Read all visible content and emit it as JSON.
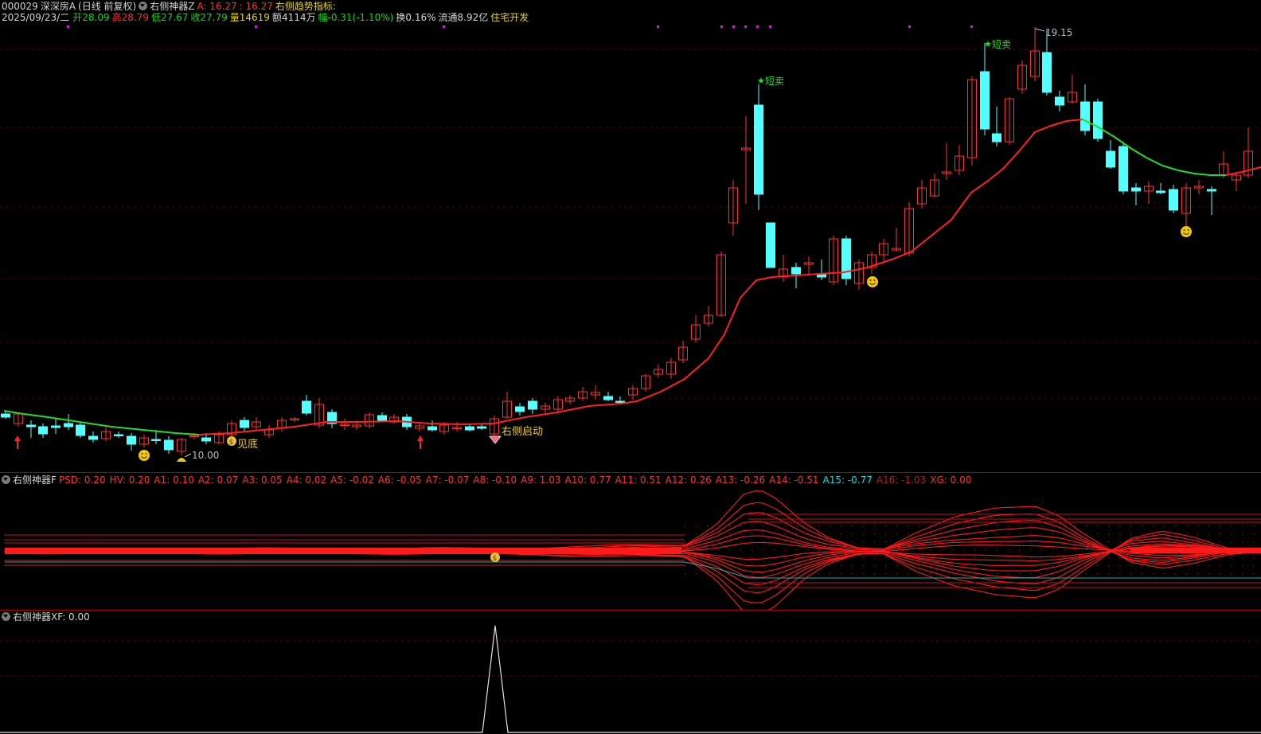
{
  "header": {
    "code": "000029",
    "name": "深深房A",
    "period": "(日线 前复权)",
    "indicator_name": "右侧神器Z",
    "a_label": "A: 16.27",
    "a_value2": ": 16.27",
    "trend_label": "右侧趋势指标:",
    "date": "2025/09/23/二",
    "open_label": "开",
    "open": "28.09",
    "high_label": "高",
    "high": "28.79",
    "low_label": "低",
    "low": "27.67",
    "close_label": "收",
    "close": "27.79",
    "vol_label": "量",
    "vol": "14619",
    "amt_label": "额",
    "amt": "4114万",
    "chg_label": "幅",
    "chg": "-0.31(-1.10%)",
    "turnover": "换0.16%",
    "float": "流通8.92亿",
    "sector": "住宅开发"
  },
  "main_chart": {
    "price_high_label": "19.15",
    "price_low_label": "10.00",
    "short_sell_label": "短卖",
    "bottom_label": "见底",
    "right_start_label": "右侧启动",
    "colors": {
      "up": "#ff3030",
      "down": "#54ffff",
      "ma_up": "#ff2020",
      "ma_down": "#22dd22",
      "bg": "#000000"
    }
  },
  "panel_f": {
    "title": "右侧神器F",
    "values": [
      {
        "k": "PSD: 0.20",
        "cls": "r"
      },
      {
        "k": "HV: 0.20",
        "cls": "r"
      },
      {
        "k": "A1: 0.10",
        "cls": "r"
      },
      {
        "k": "A2: 0.07",
        "cls": "r"
      },
      {
        "k": "A3: 0.05",
        "cls": "r"
      },
      {
        "k": "A4: 0.02",
        "cls": "r"
      },
      {
        "k": "A5: -0.02",
        "cls": "r"
      },
      {
        "k": "A6: -0.05",
        "cls": "r"
      },
      {
        "k": "A7: -0.07",
        "cls": "r"
      },
      {
        "k": "A8: -0.10",
        "cls": "r"
      },
      {
        "k": "A9: 1.03",
        "cls": "r"
      },
      {
        "k": "A10: 0.77",
        "cls": "r"
      },
      {
        "k": "A11: 0.51",
        "cls": "r"
      },
      {
        "k": "A12: 0.26",
        "cls": "r"
      },
      {
        "k": "A13: -0.26",
        "cls": "r"
      },
      {
        "k": "A14: -0.51",
        "cls": "r"
      },
      {
        "k": "A15: -0.77",
        "cls": "c"
      },
      {
        "k": "A16: -1.03",
        "cls": "dr"
      },
      {
        "k": "XG: 0.00",
        "cls": "r"
      }
    ]
  },
  "panel_xf": {
    "title": "右侧神器XF",
    "value": ": 0.00"
  }
}
